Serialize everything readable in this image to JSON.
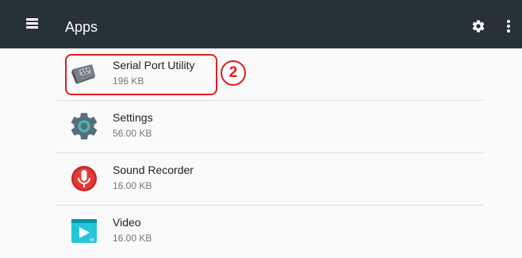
{
  "appbar": {
    "menu_icon": "hamburger-menu-icon",
    "title": "Apps",
    "settings_icon": "gear-icon",
    "overflow_icon": "more-vert-icon"
  },
  "apps": [
    {
      "name": "Serial Port Utility",
      "size": "196 KB",
      "icon": "serial-port-icon",
      "selected": true
    },
    {
      "name": "Settings",
      "size": "56.00 KB",
      "icon": "settings-gear-icon"
    },
    {
      "name": "Sound Recorder",
      "size": "16.00 KB",
      "icon": "microphone-icon"
    },
    {
      "name": "Video",
      "size": "16.00 KB",
      "icon": "video-play-icon"
    }
  ],
  "annotation": {
    "step_number": "2",
    "color": "#e01b22"
  },
  "colors": {
    "appbar": "#263238",
    "background": "#fafafa",
    "settings_teal": "#00897b",
    "recorder_red": "#c62828",
    "video_teal": "#26c6da"
  }
}
